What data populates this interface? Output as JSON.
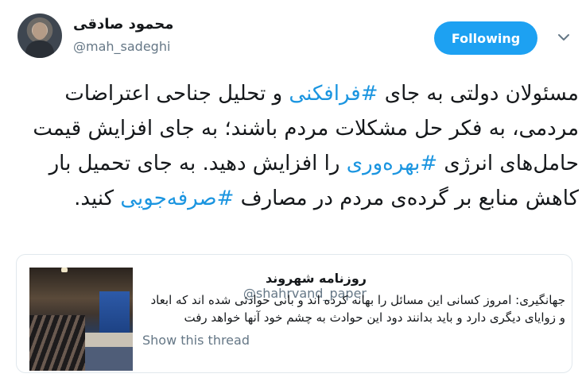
{
  "author": {
    "name": "محمود صادقی",
    "handle": "@mah_sadeghi"
  },
  "follow_label": "Following",
  "tweet": {
    "part1": "مسئولان دولتی به جای ",
    "hashtag1": "#فرافکنی",
    "part2": " و تحلیل جناحی اعتراضات مردمی، به فکر حل مشکلات مردم باشند؛ به جای افزایش قیمت حامل‌های انرژی ",
    "hashtag2": "#بهره‌وری",
    "part3": " را افزایش دهید. به جای تحمیل بار کاهش منابع بر گرده‌ی مردم در مصارف ",
    "hashtag3": "#صرفه‌جویی",
    "part4": " کنید."
  },
  "quote": {
    "name": "روزنامه شهروند",
    "handle": "@shahrvand_paper",
    "text": "جهانگیری: امروز کسانی این مسائل را بهانه کرده اند و بانی حوادثی شده اند که ابعاد و زوایای دیگری دارد و باید بدانند دود این حوادث به چشم خود آنها خواهد رفت",
    "show_thread": "Show this thread"
  },
  "icons": {
    "caret": "chevron-down-icon"
  },
  "colors": {
    "accent": "#1da1f2",
    "hashtag": "#1b95e0",
    "secondary_text": "#657786"
  }
}
